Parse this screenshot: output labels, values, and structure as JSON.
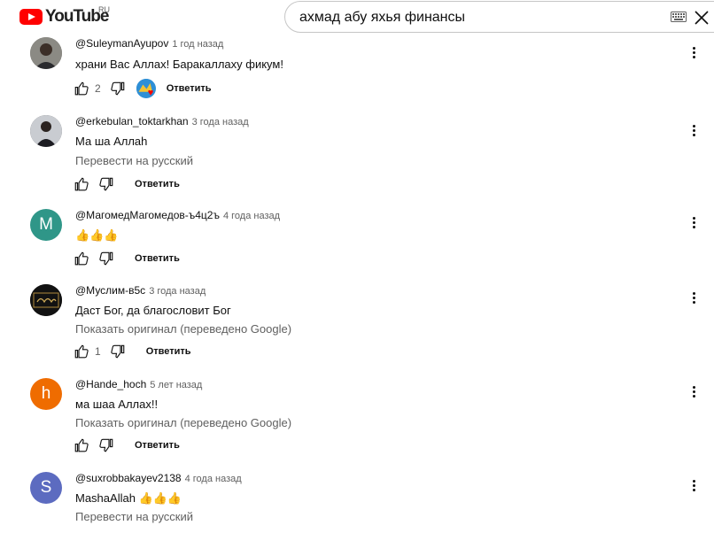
{
  "header": {
    "logo_text": "YouTube",
    "country_code": "RU",
    "search_query": "ахмад абу яхья финансы"
  },
  "comments": [
    {
      "author": "@SuleymanAyupov",
      "time": "1 год назад",
      "text": "храни Вас Аллах! Баракаллаху фикум!",
      "likes": "2",
      "reply_label": "Ответить",
      "avatar_type": "photo"
    },
    {
      "author": "@erkebulan_toktarkhan",
      "time": "3 года назад",
      "text": "Ма ша Аллаh",
      "translate_label": "Перевести на русский",
      "reply_label": "Ответить",
      "avatar_type": "photo"
    },
    {
      "author": "@МагомедМагомедов-ъ4ц2ъ",
      "time": "4 года назад",
      "text": "👍👍👍",
      "reply_label": "Ответить",
      "avatar_letter": "M",
      "avatar_color": "#2f9688"
    },
    {
      "author": "@Муслим-в5с",
      "time": "3 года назад",
      "text": "Даст Бог, да благословит Бог",
      "translate_label": "Показать оригинал (переведено Google)",
      "likes": "1",
      "reply_label": "Ответить",
      "avatar_type": "photo"
    },
    {
      "author": "@Hande_hoch",
      "time": "5 лет назад",
      "text": "ма шаа Аллах!!",
      "translate_label": "Показать оригинал (переведено Google)",
      "reply_label": "Ответить",
      "avatar_letter": "h",
      "avatar_color": "#ef6c00"
    },
    {
      "author": "@suxrobbakayev2138",
      "time": "4 года назад",
      "text": "MashaAllah 👍👍👍",
      "translate_label": "Перевести на русский",
      "avatar_letter": "S",
      "avatar_color": "#5c6bc0"
    }
  ]
}
